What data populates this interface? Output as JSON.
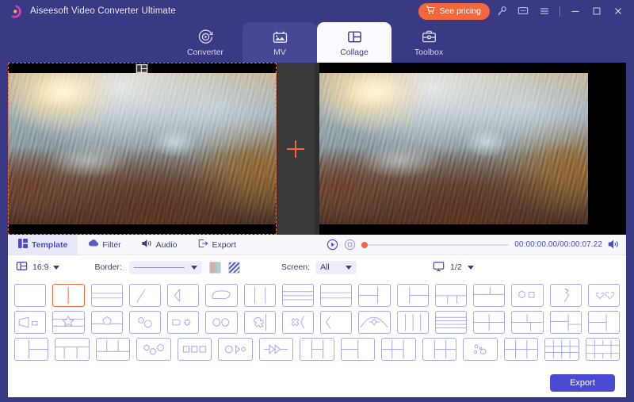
{
  "titlebar": {
    "app_name": "Aiseesoft Video Converter Ultimate",
    "pricing_label": "See pricing",
    "icons": [
      "cart-icon",
      "key-icon",
      "feedback-icon",
      "menu-icon",
      "minimize-icon",
      "maximize-icon",
      "close-icon"
    ]
  },
  "tabs": [
    {
      "label": "Converter",
      "icon": "converter-icon",
      "state": "inactive"
    },
    {
      "label": "MV",
      "icon": "mv-icon",
      "state": "hover"
    },
    {
      "label": "Collage",
      "icon": "collage-icon",
      "state": "active"
    },
    {
      "label": "Toolbox",
      "icon": "toolbox-icon",
      "state": "inactive"
    }
  ],
  "preview": {
    "left_pane": {
      "name": "video-clip-1",
      "selected": true,
      "crop_handle": "filmstrip-icon"
    },
    "add_pane": {
      "label": "+",
      "name": "add-media-button"
    },
    "right_pane": {
      "name": "collage-output-preview"
    }
  },
  "edit_tabs": [
    {
      "label": "Template",
      "icon": "template-icon",
      "active": true
    },
    {
      "label": "Filter",
      "icon": "filter-icon",
      "active": false
    },
    {
      "label": "Audio",
      "icon": "audio-icon",
      "active": false
    },
    {
      "label": "Export",
      "icon": "export-icon",
      "active": false
    }
  ],
  "player": {
    "play_icon": "play-circle-icon",
    "stop_icon": "stop-square-icon",
    "progress_percent": 0,
    "timecode": "00:00:00.00/00:00:07.22",
    "volume_icon": "volume-icon"
  },
  "options": {
    "aspect_icon": "aspect-ratio-icon",
    "aspect_value": "16:9",
    "border_label": "Border:",
    "border_style_value": "solid-line",
    "color_swatch_icon": "color-grid-icon",
    "pattern_swatch_icon": "diagonal-stripe-icon",
    "screen_label": "Screen:",
    "screen_value": "All",
    "monitor_icon": "monitor-icon",
    "page_value": "1/2"
  },
  "templates": {
    "rows": [
      [
        {
          "name": "single",
          "selected": false
        },
        {
          "name": "two-column",
          "selected": true
        },
        {
          "name": "two-row",
          "selected": false
        },
        {
          "name": "diagonal-split",
          "selected": false
        },
        {
          "name": "arrow-notch",
          "selected": false
        },
        {
          "name": "rounded-blob",
          "selected": false
        },
        {
          "name": "three-column",
          "selected": false
        },
        {
          "name": "three-row",
          "selected": false
        },
        {
          "name": "three-row-alt",
          "selected": false
        },
        {
          "name": "left-stack-right",
          "selected": false
        },
        {
          "name": "left-right-stack",
          "selected": false
        },
        {
          "name": "t-bottom-split",
          "selected": false
        },
        {
          "name": "t-top-split",
          "selected": false
        },
        {
          "name": "hexagon-square",
          "selected": false
        },
        {
          "name": "lightning-split",
          "selected": false
        },
        {
          "name": "two-hearts",
          "selected": false
        }
      ],
      [
        {
          "name": "trapezoid-square",
          "selected": false
        },
        {
          "name": "star-band",
          "selected": false
        },
        {
          "name": "pentagon-center",
          "selected": false
        },
        {
          "name": "two-circles-small",
          "selected": false
        },
        {
          "name": "rounded-gear",
          "selected": false
        },
        {
          "name": "two-ovals",
          "selected": false
        },
        {
          "name": "puzzle-piece",
          "selected": false
        },
        {
          "name": "x-shape",
          "selected": false
        },
        {
          "name": "chevron-left",
          "selected": false
        },
        {
          "name": "arc-diamond",
          "selected": false
        },
        {
          "name": "four-column",
          "selected": false
        },
        {
          "name": "four-row",
          "selected": false
        },
        {
          "name": "quad-grid",
          "selected": false
        },
        {
          "name": "grid-left-right-split",
          "selected": false
        },
        {
          "name": "grid-top-split",
          "selected": false
        },
        {
          "name": "two-row-right-pane",
          "selected": false
        }
      ],
      [
        {
          "name": "left-pane-two-right",
          "selected": false
        },
        {
          "name": "top-band-three-bottom",
          "selected": false
        },
        {
          "name": "three-top-bottom-band",
          "selected": false
        },
        {
          "name": "three-circles",
          "selected": false
        },
        {
          "name": "three-squares",
          "selected": false
        },
        {
          "name": "circle-arrow-dot",
          "selected": false
        },
        {
          "name": "double-arrow",
          "selected": false
        },
        {
          "name": "grid-mixed-a",
          "selected": false
        },
        {
          "name": "grid-mixed-b",
          "selected": false
        },
        {
          "name": "grid-2x2-right",
          "selected": false
        },
        {
          "name": "grid-left-2x2",
          "selected": false
        },
        {
          "name": "bubbles",
          "selected": false
        },
        {
          "name": "six-grid",
          "selected": false
        },
        {
          "name": "nine-grid",
          "selected": false
        },
        {
          "name": "complex-grid",
          "selected": false
        }
      ]
    ]
  },
  "footer": {
    "export_label": "Export"
  },
  "colors": {
    "window_bg": "#3a3a84",
    "accent_orange": "#f4663c",
    "accent_blue": "#4a4ad0",
    "panel_white": "#ffffff",
    "template_stroke": "#a9aae8"
  }
}
